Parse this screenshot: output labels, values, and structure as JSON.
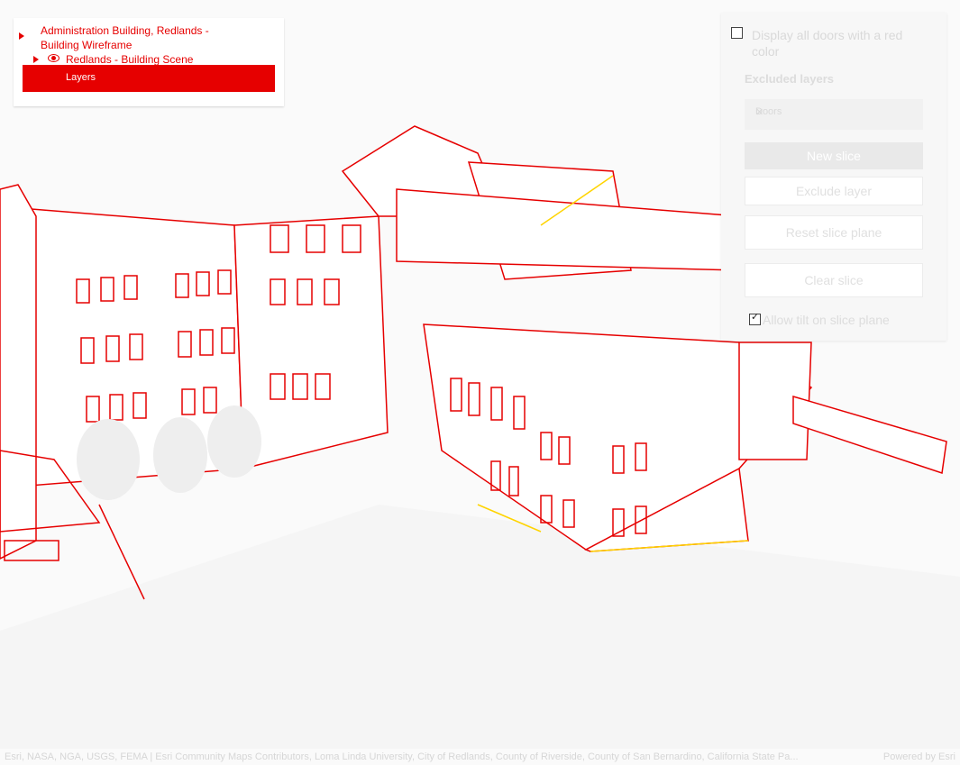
{
  "layer_list": {
    "item1_title": "Administration Building, Redlands - Building Wireframe",
    "item2_title": "Redlands - Building Scene",
    "selected_title": "Layers"
  },
  "slice_panel": {
    "checkbox_doors_label": "Display all doors with a red color",
    "excluded_heading": "Excluded layers",
    "excluded_items": [
      "Doors"
    ],
    "new_slice_label": "New slice",
    "exclude_layer_label": "Exclude layer",
    "reset_plane_label": "Reset slice plane",
    "clear_slice_label": "Clear slice",
    "allow_tilt_label": "Allow tilt on slice plane",
    "allow_tilt_checked": true,
    "doors_checked": false
  },
  "attribution": {
    "text": "Esri, NASA, NGA, USGS, FEMA | Esri Community Maps Contributors, Loma Linda University, City of Redlands, County of Riverside, County of San Bernardino, California State Pa...",
    "powered_by": "Powered by Esri"
  },
  "colors": {
    "accent": "#e60000",
    "highlight": "#ffd400"
  },
  "icons": {
    "caret": "caret-right-icon",
    "visibility": "eye-icon",
    "close": "close-icon"
  }
}
